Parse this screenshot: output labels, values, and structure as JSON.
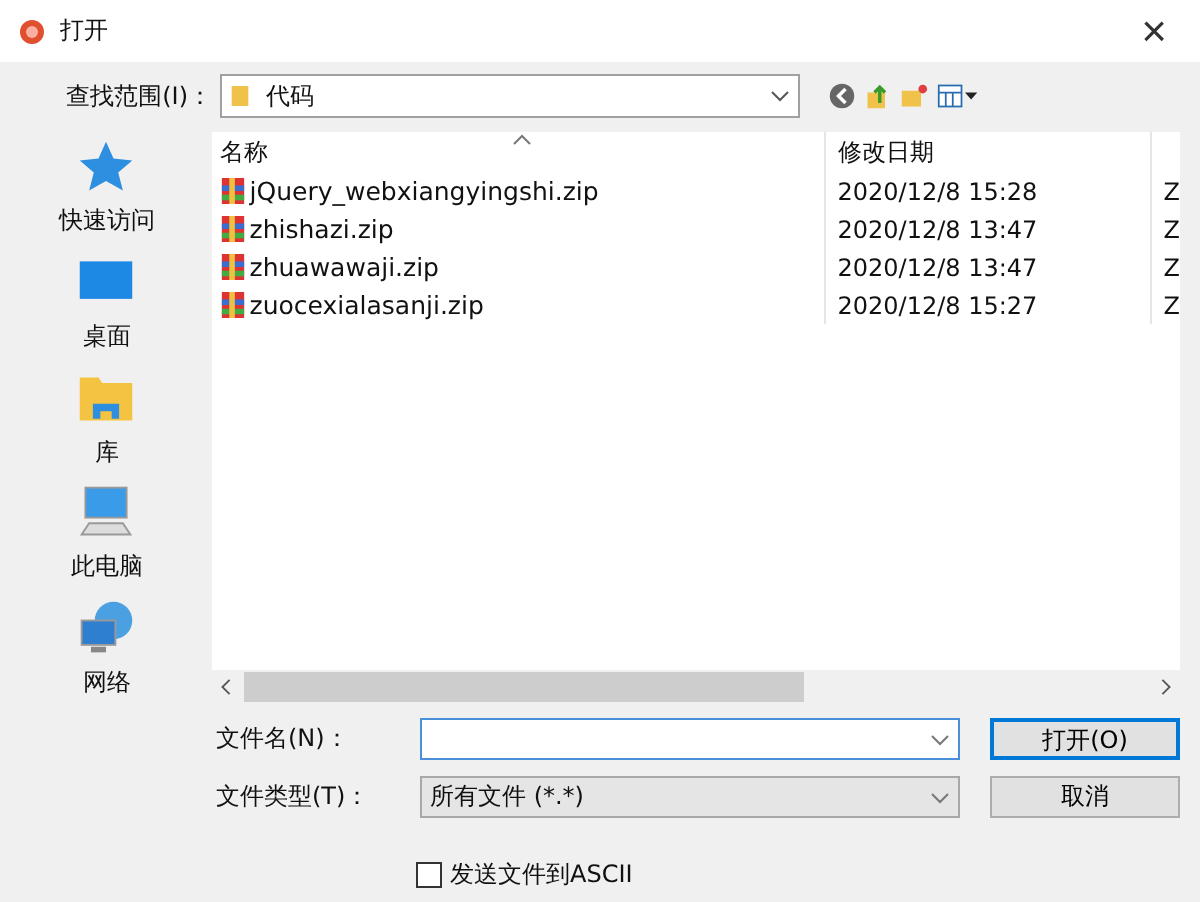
{
  "window": {
    "title": "打开",
    "close": "×"
  },
  "location": {
    "label": "查找范围(I)：",
    "value": "代码"
  },
  "places": [
    {
      "label": "快速访问",
      "kind": "star"
    },
    {
      "label": "桌面",
      "kind": "desktop"
    },
    {
      "label": "库",
      "kind": "library"
    },
    {
      "label": "此电脑",
      "kind": "computer"
    },
    {
      "label": "网络",
      "kind": "network"
    }
  ],
  "table": {
    "columns": [
      "名称",
      "修改日期"
    ],
    "rows": [
      {
        "name": "jQuery_webxiangyingshi.zip",
        "date": "2020/12/8 15:28",
        "column_3": "Z"
      },
      {
        "name": "zhishazi.zip",
        "date": "2020/12/8 13:47",
        "column_3": "Z"
      },
      {
        "name": "zhuawawaji.zip",
        "date": "2020/12/8 13:47",
        "column_3": "Z"
      },
      {
        "name": "zuocexialasanji.zip",
        "date": "2020/12/8 15:27",
        "column_3": "Z"
      }
    ]
  },
  "filename": {
    "label": "文件名(N)："
  },
  "filetype": {
    "label": "文件类型(T)：",
    "value": "所有文件 (*.*)"
  },
  "buttons": [
    "打开(O)",
    "取消"
  ],
  "checkbox": {
    "label": "发送文件到ASCII",
    "checked": false
  }
}
